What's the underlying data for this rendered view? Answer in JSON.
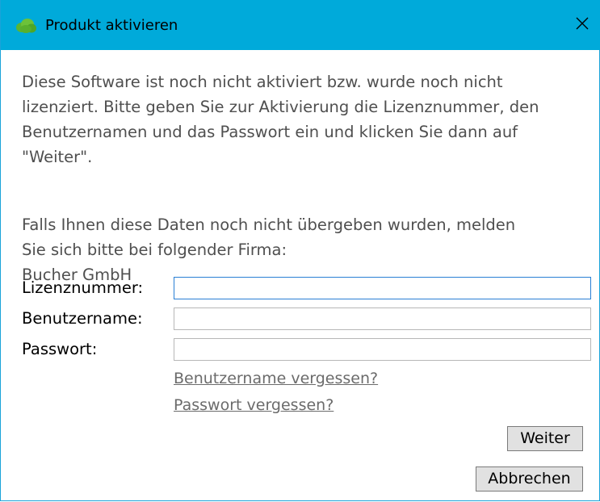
{
  "window": {
    "title": "Produkt aktivieren",
    "title_bar_color": "#00aada",
    "app_icon": "green-cloud-icon",
    "close_icon": "close-icon"
  },
  "intro": {
    "paragraph1": "Diese Software ist noch nicht aktiviert bzw. wurde noch nicht\nlizenziert. Bitte geben Sie zur Aktivierung die Lizenznummer, den\nBenutzernamen und das Passwort ein und klicken Sie dann auf\n\"Weiter\".",
    "paragraph2": "Falls Ihnen diese Daten noch nicht übergeben wurden, melden\nSie sich bitte bei folgender Firma:",
    "company": "Bucher GmbH"
  },
  "form": {
    "license_label": "Lizenznummer:",
    "license_value": "",
    "username_label": "Benutzername:",
    "username_value": "",
    "password_label": "Passwort:",
    "password_value": ""
  },
  "links": {
    "forgot_username": "Benutzername vergessen?",
    "forgot_password": "Passwort vergessen?"
  },
  "buttons": {
    "next": "Weiter",
    "cancel": "Abbrechen"
  }
}
